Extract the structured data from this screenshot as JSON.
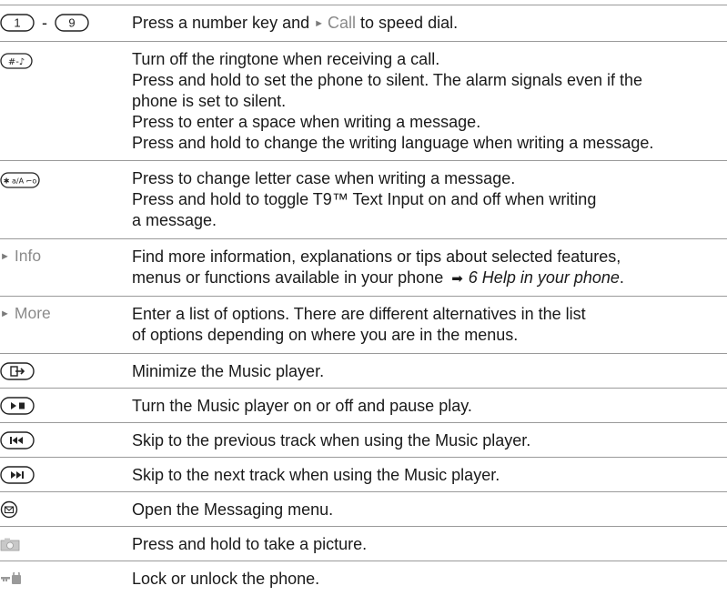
{
  "rows": [
    {
      "key_icons": [
        "key-1-icon",
        "key-9-icon"
      ],
      "key_separator": "-",
      "lines_before": "Press a number key and ",
      "inline_softkey": "Call",
      "lines_after": " to speed dial."
    },
    {
      "key_icons": [
        "hash-key-icon"
      ],
      "lines": [
        "Turn off the ringtone when receiving a call.",
        "Press and hold to set the phone to silent. The alarm signals even if the",
        "phone is set to silent.",
        "Press to enter a space when writing a message.",
        "Press and hold to change the writing language when writing a message."
      ]
    },
    {
      "key_icons": [
        "star-key-icon"
      ],
      "lines": [
        "Press to change letter case when writing a message.",
        "Press and hold to toggle T9™ Text Input on and off when writing",
        "a message."
      ]
    },
    {
      "softkey": "Info",
      "lines": [
        "Find more information, explanations or tips about selected features,"
      ],
      "last_line_before": "menus or functions available in your phone ",
      "last_line_ref": "6 Help in your phone",
      "last_line_after": "."
    },
    {
      "softkey": "More",
      "lines": [
        "Enter a list of options. There are different alternatives in the list",
        "of options depending on where you are in the menus."
      ]
    },
    {
      "key_icons": [
        "minimize-key-icon"
      ],
      "lines": [
        "Minimize the Music player."
      ]
    },
    {
      "key_icons": [
        "play-pause-key-icon"
      ],
      "lines": [
        "Turn the Music player on or off and pause play."
      ]
    },
    {
      "key_icons": [
        "previous-track-key-icon"
      ],
      "lines": [
        "Skip to the previous track when using the Music player."
      ]
    },
    {
      "key_icons": [
        "next-track-key-icon"
      ],
      "lines": [
        "Skip to the next track when using the Music player."
      ]
    },
    {
      "key_icons": [
        "messaging-key-icon"
      ],
      "lines": [
        "Open the Messaging menu."
      ]
    },
    {
      "key_icons": [
        "camera-key-icon"
      ],
      "lines": [
        "Press and hold to take a picture."
      ]
    },
    {
      "key_icons": [
        "lock-key-icon"
      ],
      "lines": [
        "Lock or unlock the phone."
      ]
    }
  ],
  "key_labels": {
    "one": "1",
    "nine": "9",
    "hash": "#-♪",
    "star": "✱ a/A ⌐o"
  }
}
